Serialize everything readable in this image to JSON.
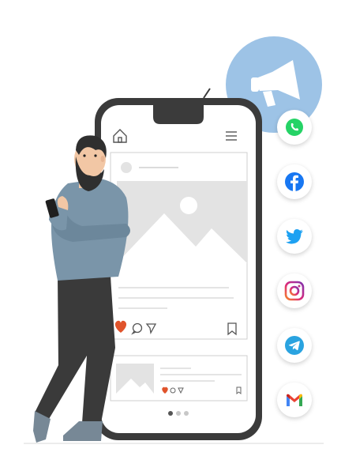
{
  "illustration": {
    "subject": "man-with-smartphone-social-media",
    "icons": [
      "megaphone-icon",
      "home-icon",
      "menu-icon",
      "image-placeholder-icon",
      "heart-icon",
      "comment-icon",
      "share-icon",
      "bookmark-icon"
    ],
    "social_networks": [
      {
        "name": "whatsapp-icon",
        "color": "#25D366"
      },
      {
        "name": "facebook-icon",
        "color": "#1877F2"
      },
      {
        "name": "twitter-icon",
        "color": "#1DA1F2"
      },
      {
        "name": "instagram-icon",
        "color": "#C13584"
      },
      {
        "name": "telegram-icon",
        "color": "#2AA3E0"
      },
      {
        "name": "gmail-icon",
        "color": "#EA4335"
      }
    ],
    "colors": {
      "phone_frame": "#3b3b3b",
      "megaphone_circle": "#9dc3e6",
      "heart": "#e0532b",
      "sweater": "#7a95a9",
      "pants": "#3a3a3a",
      "skin": "#f2c7a5",
      "beard": "#2f2f2f",
      "placeholder": "#e3e3e3"
    }
  }
}
